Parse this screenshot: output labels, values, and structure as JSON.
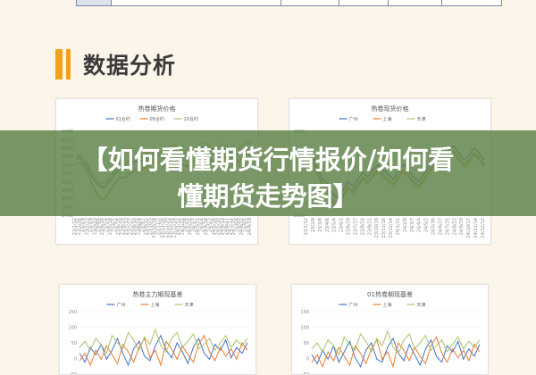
{
  "section": {
    "title": "数据分析"
  },
  "banner": {
    "line1": "【如何看懂期货行情报价/如何看",
    "line2": "懂期货走势图】"
  },
  "colors": {
    "blue": "#4472c4",
    "orange": "#ed7d31",
    "green": "#a9c46b",
    "banner": "#5c8046",
    "accent": "#f0a21b"
  },
  "chart_data": [
    {
      "type": "line",
      "title": "热卷期货价格",
      "legend": [
        "01合约",
        "05合约",
        "10合约"
      ],
      "yticks": [
        "4400",
        "4200",
        "4000",
        "3800",
        "3600",
        "3400",
        "3200",
        "3000",
        "2800",
        "2600",
        "2400"
      ],
      "ylim": [
        2400,
        4400
      ],
      "xticks": [
        "23/1/12",
        "23/1/26",
        "23/2/9",
        "23/2/23",
        "23/3/9",
        "23/3/23",
        "23/4/6",
        "23/4/20",
        "23/5/4",
        "23/5/18",
        "23/6/1",
        "23/6/15",
        "23/6/29",
        "23/7/13",
        "23/7/27",
        "23/8/10",
        "23/8/24",
        "23/9/7",
        "23/9/21",
        "23/10/5",
        "23/10/19",
        "23/11/2",
        "23/11/16",
        "23/11/30",
        "23/12/14",
        "23/12/28",
        "24/1/11",
        "24/1/25",
        "24/2/8",
        "24/2/22",
        "24/3/7",
        "24/3/21",
        "24/4/4",
        "24/4/18",
        "24/5/2",
        "24/5/16",
        "24/5/30",
        "24/6/13",
        "24/6/27",
        "24/7/11",
        "24/7/25",
        "24/8/8",
        "24/8/22",
        "24/9/5",
        "24/9/19"
      ],
      "series": [
        {
          "name": "01合约",
          "values": [
            3720,
            3780,
            3650,
            3550,
            3320,
            3180,
            3100,
            3050,
            3150,
            3280,
            3420,
            3500,
            3480,
            3550,
            3620,
            3700,
            3650,
            3720,
            3780,
            3850,
            3900,
            3820,
            3760,
            3840,
            3900,
            3960,
            3880,
            3800,
            3760,
            3840,
            3900,
            3980,
            4050,
            3980,
            3900,
            3860,
            3920,
            4000,
            3940,
            3880,
            3820,
            3900,
            3980,
            4050,
            4000
          ]
        },
        {
          "name": "05合约",
          "values": [
            3620,
            3650,
            3580,
            3400,
            3150,
            2950,
            2820,
            2780,
            2900,
            3050,
            3180,
            3300,
            3280,
            3350,
            3420,
            3480,
            3430,
            3500,
            3560,
            3620,
            3700,
            3640,
            3560,
            3640,
            3700,
            3760,
            3680,
            3600,
            3560,
            3640,
            3700,
            3780,
            3840,
            3780,
            3700,
            3660,
            3720,
            3800,
            3740,
            3680,
            3620,
            3700,
            3780,
            3860,
            3800
          ]
        },
        {
          "name": "10合约",
          "values": [
            3800,
            3850,
            3760,
            3640,
            3420,
            3280,
            3180,
            3140,
            3240,
            3380,
            3520,
            3600,
            3580,
            3660,
            3720,
            3800,
            3760,
            3820,
            3880,
            3950,
            4000,
            3920,
            3860,
            3940,
            4000,
            4060,
            3980,
            3900,
            3860,
            3940,
            4000,
            4080,
            4150,
            4080,
            4000,
            3960,
            4020,
            4100,
            4040,
            3980,
            3920,
            4000,
            4080,
            4150,
            4100
          ]
        }
      ]
    },
    {
      "type": "line",
      "title": "热卷现货价格",
      "legend": [
        "广州",
        "上海",
        "天津"
      ],
      "yticks": [
        "4300",
        "3600"
      ],
      "ylim": [
        3600,
        4300
      ],
      "xticks": [
        "23/1/12",
        "23/2/9",
        "23/3/9",
        "23/4/6",
        "23/5/4",
        "23/6/1",
        "23/6/29",
        "23/7/27",
        "23/8/24",
        "23/9/21",
        "23/10/19",
        "23/11/16",
        "23/12/14",
        "24/1/11",
        "24/2/8",
        "24/3/7",
        "24/4/4",
        "24/5/2",
        "24/5/30",
        "24/6/27",
        "24/7/25",
        "24/8/22",
        "24/9/19",
        "24/10/17",
        "24/11/14",
        "24/12/12"
      ],
      "series": [
        {
          "name": "广州",
          "values": [
            4060,
            4100,
            4000,
            3900,
            3860,
            3780,
            3740,
            3800,
            3880,
            3840,
            3900,
            3960,
            3920,
            3980,
            4020,
            3980,
            3940,
            3900,
            3960,
            4020,
            3980,
            3920,
            3880,
            3940,
            4000,
            4060,
            4120,
            4080,
            4140,
            4180,
            4120,
            4060,
            4100,
            4160,
            4120,
            4060
          ]
        },
        {
          "name": "上海",
          "values": [
            4020,
            4060,
            3960,
            3860,
            3800,
            3720,
            3690,
            3760,
            3840,
            3800,
            3860,
            3920,
            3880,
            3940,
            3980,
            3940,
            3900,
            3860,
            3920,
            3980,
            3940,
            3880,
            3840,
            3900,
            3960,
            4020,
            4080,
            4040,
            4100,
            4140,
            4080,
            4020,
            4060,
            4120,
            4080,
            4020
          ]
        },
        {
          "name": "天津",
          "values": [
            4000,
            4040,
            3940,
            3840,
            3780,
            3700,
            3660,
            3740,
            3820,
            3780,
            3840,
            3900,
            3860,
            3920,
            3960,
            3920,
            3880,
            3840,
            3900,
            3960,
            3920,
            3860,
            3820,
            3880,
            3940,
            4000,
            4060,
            4020,
            4080,
            4120,
            4060,
            4000,
            4040,
            4100,
            4060,
            4000
          ]
        }
      ]
    },
    {
      "type": "line",
      "title": "热卷主力期现基差",
      "legend": [
        "广州",
        "上海",
        "天津"
      ],
      "yticks": [
        "150",
        "100",
        "50",
        "0",
        "-50"
      ],
      "ylim": [
        -60,
        150
      ],
      "series": [
        {
          "name": "广州",
          "values": [
            10,
            -20,
            30,
            5,
            40,
            -10,
            20,
            60,
            10,
            -30,
            25,
            50,
            0,
            -15,
            35,
            70,
            20,
            -5,
            45,
            15,
            -25,
            30,
            60,
            10,
            -10,
            40,
            20,
            55,
            -5,
            30,
            10,
            45
          ]
        },
        {
          "name": "上海",
          "values": [
            -15,
            10,
            -30,
            20,
            -10,
            35,
            5,
            -25,
            40,
            15,
            -20,
            30,
            60,
            -5,
            20,
            -30,
            50,
            25,
            -10,
            35,
            5,
            -20,
            40,
            70,
            15,
            -15,
            30,
            0,
            25,
            -10,
            45,
            20
          ]
        },
        {
          "name": "天津",
          "values": [
            30,
            50,
            20,
            60,
            40,
            10,
            70,
            45,
            25,
            80,
            55,
            20,
            65,
            40,
            90,
            35,
            15,
            60,
            80,
            30,
            50,
            75,
            25,
            40,
            60,
            20,
            45,
            70,
            30,
            55,
            35,
            60
          ]
        }
      ]
    },
    {
      "type": "line",
      "title": "01热卷期现基差",
      "legend": [
        "广州",
        "上海",
        "天津"
      ],
      "yticks": [
        "150",
        "100",
        "50",
        "0",
        "-50"
      ],
      "ylim": [
        -60,
        150
      ],
      "series": [
        {
          "name": "广州",
          "values": [
            5,
            -25,
            20,
            -10,
            35,
            -20,
            15,
            50,
            -5,
            -35,
            20,
            45,
            -10,
            -20,
            30,
            60,
            10,
            -15,
            40,
            5,
            -30,
            25,
            55,
            0,
            -20,
            35,
            15,
            50,
            -10,
            25,
            0,
            40
          ]
        },
        {
          "name": "上海",
          "values": [
            -20,
            5,
            -35,
            15,
            -15,
            30,
            0,
            -30,
            35,
            10,
            -25,
            25,
            55,
            -10,
            15,
            -35,
            45,
            20,
            -15,
            30,
            0,
            -25,
            35,
            65,
            10,
            -20,
            25,
            -5,
            20,
            -15,
            40,
            15
          ]
        },
        {
          "name": "天津",
          "values": [
            25,
            45,
            15,
            55,
            35,
            5,
            65,
            40,
            20,
            75,
            50,
            15,
            60,
            35,
            85,
            30,
            10,
            55,
            75,
            25,
            45,
            70,
            20,
            35,
            55,
            15,
            40,
            65,
            25,
            50,
            30,
            55
          ]
        }
      ]
    }
  ]
}
